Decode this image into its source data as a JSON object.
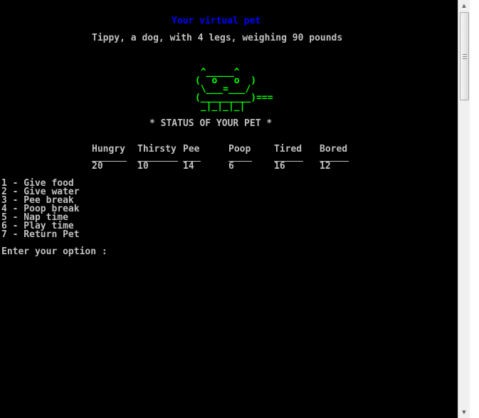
{
  "title": "Your virtual pet",
  "pet_description": "Tippy, a dog, with 4 legs, weighing 90 pounds",
  "ascii_art": [
    " ^_____^",
    "(  o   o  )",
    " \\___=___/",
    "(_________)===",
    " _|_|_|_|"
  ],
  "status_heading": "* STATUS OF YOUR PET *",
  "stats": {
    "headers": [
      "Hungry",
      "Thirsty",
      "Pee",
      "Poop",
      "Tired",
      "Bored"
    ],
    "values": [
      "20",
      "10",
      "14",
      "6",
      "16",
      "12"
    ]
  },
  "menu": [
    "1 - Give food",
    "2 - Give water",
    "3 - Pee break",
    "4 - Poop break",
    "5 - Nap time",
    "6 - Play time",
    "7 - Return Pet"
  ],
  "prompt": "Enter your option :",
  "colors": {
    "title": "#0000ff",
    "art": "#00ff00",
    "text": "#c0c0c0",
    "background": "#000000"
  },
  "icons": {
    "scroll_up": "scroll-up-arrow-icon",
    "scroll_down": "scroll-down-arrow-icon"
  }
}
